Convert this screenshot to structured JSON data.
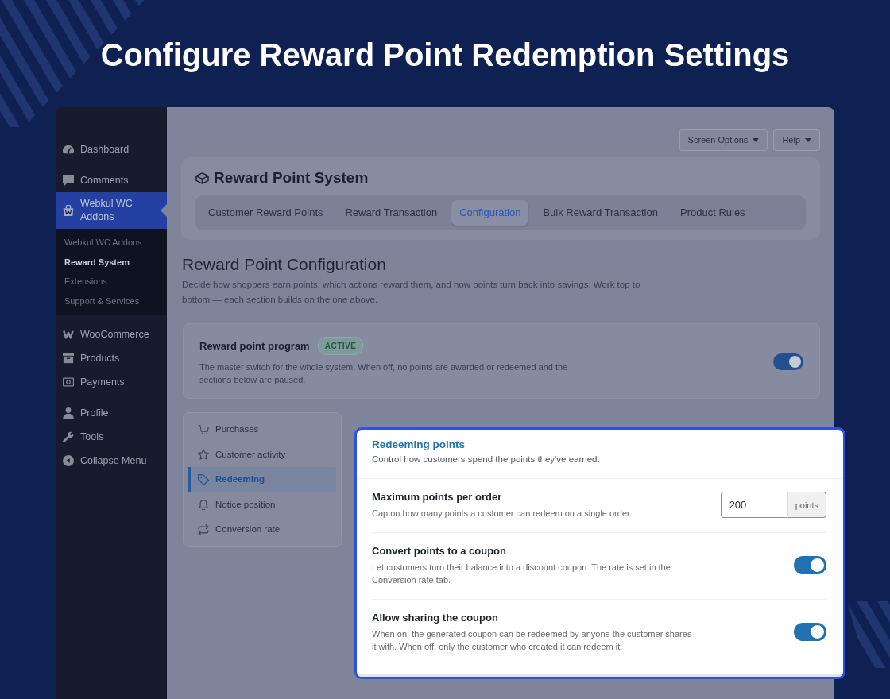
{
  "banner_title": "Configure Reward Point Redemption Settings",
  "sidebar": {
    "groups": [
      {
        "items": [
          {
            "label": "Dashboard",
            "selected": false
          }
        ]
      },
      {
        "items": [
          {
            "label": "Comments",
            "selected": false
          },
          {
            "label": "Webkul WC Addons",
            "selected": true,
            "children": [
              {
                "label": "Webkul WC Addons",
                "selected": false
              },
              {
                "label": "Reward System",
                "selected": true
              },
              {
                "label": "Extensions",
                "selected": false
              },
              {
                "label": "Support & Services",
                "selected": false
              }
            ]
          }
        ]
      },
      {
        "items": [
          {
            "label": "WooCommerce",
            "selected": false
          },
          {
            "label": "Products",
            "selected": false
          },
          {
            "label": "Payments",
            "selected": false
          }
        ]
      },
      {
        "items": [
          {
            "label": "Profile",
            "selected": false
          },
          {
            "label": "Tools",
            "selected": false
          },
          {
            "label": "Collapse Menu",
            "selected": false
          }
        ]
      }
    ]
  },
  "screen_meta_buttons": [
    {
      "label": "Screen Options"
    },
    {
      "label": "Help"
    }
  ],
  "plugin_header": {
    "title": "Reward Point System",
    "tabs": [
      {
        "label": "Customer Reward Points",
        "selected": false
      },
      {
        "label": "Reward Transaction",
        "selected": false
      },
      {
        "label": "Configuration",
        "selected": true
      },
      {
        "label": "Bulk Reward Transaction",
        "selected": false
      },
      {
        "label": "Product Rules",
        "selected": false
      }
    ]
  },
  "page": {
    "title": "Reward Point Configuration",
    "description": "Decide how shoppers earn points, which actions reward them, and how points turn back into savings. Work top to bottom — each section builds on the one above."
  },
  "program_card": {
    "title": "Reward point program",
    "badge": "ACTIVE",
    "description": "The master switch for the whole system. When off, no points are awarded or redeemed and the sections below are paused.",
    "on": true
  },
  "section_nav": {
    "items": [
      {
        "label": "Purchases",
        "selected": false
      },
      {
        "label": "Customer activity",
        "selected": false
      },
      {
        "label": "Redeeming",
        "selected": true
      },
      {
        "label": "Notice position",
        "selected": false
      },
      {
        "label": "Conversion rate",
        "selected": false
      }
    ]
  },
  "section_panel": {
    "title": "Redeeming points",
    "description": "Control how customers spend the points they've earned.",
    "settings": [
      {
        "kind": "number",
        "title": "Maximum points per order",
        "description": "Cap on how many points a customer can redeem on a single order.",
        "value": "200",
        "unit": "points"
      },
      {
        "kind": "toggle",
        "title": "Convert points to a coupon",
        "description": "Let customers turn their balance into a discount coupon. The rate is set in the Conversion rate tab.",
        "on": true
      },
      {
        "kind": "toggle",
        "title": "Allow sharing the coupon",
        "description": "When on, the generated coupon can be redeemed by anyone the customer shares it with. When off, only the customer who created it can redeem it.",
        "on": true
      }
    ]
  }
}
